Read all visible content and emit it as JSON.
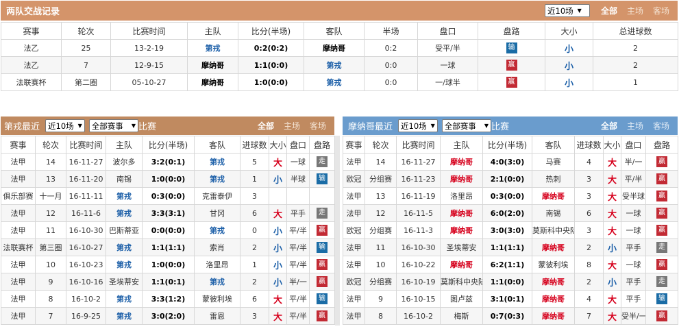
{
  "h2h": {
    "title": "两队交战记录",
    "select": "近10场",
    "filters": [
      "全部",
      "主场",
      "客场"
    ],
    "headers": [
      "赛事",
      "轮次",
      "比赛时间",
      "主队",
      "比分(半场)",
      "客队",
      "半场",
      "盘口",
      "盘路",
      "大小",
      "总进球数"
    ],
    "rows": [
      [
        "法乙",
        "25",
        "13-2-19",
        "第戎",
        "0:2(0:2)",
        "摩纳哥",
        "0:2",
        "受平/半",
        "输",
        "小",
        "2"
      ],
      [
        "法乙",
        "7",
        "12-9-15",
        "摩纳哥",
        "1:1(0:0)",
        "第戎",
        "0:0",
        "一球",
        "赢",
        "小",
        "2"
      ],
      [
        "法联赛杯",
        "第二圈",
        "05-10-27",
        "摩纳哥",
        "1:0(0:0)",
        "第戎",
        "0:0",
        "一/球半",
        "赢",
        "小",
        "1"
      ]
    ]
  },
  "left": {
    "title": "第戎最近",
    "select1": "近10场",
    "select2": "全部赛事",
    "suffix": "比赛",
    "filters": [
      "全部",
      "主场",
      "客场"
    ],
    "headers": [
      "赛事",
      "轮次",
      "比赛时间",
      "主队",
      "比分(半场)",
      "客队",
      "进球数",
      "大小",
      "盘口",
      "盘路"
    ],
    "rows": [
      [
        "法甲",
        "14",
        "16-11-27",
        "波尔多",
        "3:2(0:1)",
        "第戎",
        "5",
        "大",
        "一球",
        "走"
      ],
      [
        "法甲",
        "13",
        "16-11-20",
        "南锡",
        "1:0(0:0)",
        "第戎",
        "1",
        "小",
        "半球",
        "输"
      ],
      [
        "俱乐部赛",
        "十一月",
        "16-11-11",
        "第戎",
        "0:3(0:0)",
        "克雷泰伊",
        "3",
        "",
        "",
        ""
      ],
      [
        "法甲",
        "12",
        "16-11-6",
        "第戎",
        "3:3(3:1)",
        "甘冈",
        "6",
        "大",
        "平手",
        "走"
      ],
      [
        "法甲",
        "11",
        "16-10-30",
        "巴斯蒂亚",
        "0:0(0:0)",
        "第戎",
        "0",
        "小",
        "平/半",
        "赢"
      ],
      [
        "法联赛杯",
        "第三圈",
        "16-10-27",
        "第戎",
        "1:1(1:1)",
        "索肖",
        "2",
        "小",
        "平/半",
        "输"
      ],
      [
        "法甲",
        "10",
        "16-10-23",
        "第戎",
        "1:0(0:0)",
        "洛里昂",
        "1",
        "小",
        "平/半",
        "赢"
      ],
      [
        "法甲",
        "9",
        "16-10-16",
        "圣埃蒂安",
        "1:1(0:1)",
        "第戎",
        "2",
        "小",
        "半/一",
        "赢"
      ],
      [
        "法甲",
        "8",
        "16-10-2",
        "第戎",
        "3:3(1:2)",
        "蒙彼利埃",
        "6",
        "大",
        "平/半",
        "输"
      ],
      [
        "法甲",
        "7",
        "16-9-25",
        "第戎",
        "3:0(2:0)",
        "雷恩",
        "3",
        "大",
        "平/半",
        "赢"
      ]
    ]
  },
  "right": {
    "title": "摩纳哥最近",
    "select1": "近10场",
    "select2": "全部赛事",
    "suffix": "比赛",
    "filters": [
      "全部",
      "主场",
      "客场"
    ],
    "headers": [
      "赛事",
      "轮次",
      "比赛时间",
      "主队",
      "比分(半场)",
      "客队",
      "进球数",
      "大小",
      "盘口",
      "盘路"
    ],
    "rows": [
      [
        "法甲",
        "14",
        "16-11-27",
        "摩纳哥",
        "4:0(3:0)",
        "马赛",
        "4",
        "大",
        "半/一",
        "赢"
      ],
      [
        "欧冠",
        "分组赛",
        "16-11-23",
        "摩纳哥",
        "2:1(0:0)",
        "热刺",
        "3",
        "大",
        "平/半",
        "赢"
      ],
      [
        "法甲",
        "13",
        "16-11-19",
        "洛里昂",
        "0:3(0:0)",
        "摩纳哥",
        "3",
        "大",
        "受半球",
        "赢"
      ],
      [
        "法甲",
        "12",
        "16-11-5",
        "摩纳哥",
        "6:0(2:0)",
        "南锡",
        "6",
        "大",
        "一球",
        "赢"
      ],
      [
        "欧冠",
        "分组赛",
        "16-11-3",
        "摩纳哥",
        "3:0(3:0)",
        "莫斯科中央陆军",
        "3",
        "大",
        "一球",
        "赢"
      ],
      [
        "法甲",
        "11",
        "16-10-30",
        "圣埃蒂安",
        "1:1(1:1)",
        "摩纳哥",
        "2",
        "小",
        "平手",
        "走"
      ],
      [
        "法甲",
        "10",
        "16-10-22",
        "摩纳哥",
        "6:2(1:1)",
        "蒙彼利埃",
        "8",
        "大",
        "一球",
        "赢"
      ],
      [
        "欧冠",
        "分组赛",
        "16-10-19",
        "莫斯科中央陆军",
        "1:1(0:0)",
        "摩纳哥",
        "2",
        "小",
        "平手",
        "走"
      ],
      [
        "法甲",
        "9",
        "16-10-15",
        "图卢兹",
        "3:1(0:1)",
        "摩纳哥",
        "4",
        "大",
        "平手",
        "输"
      ],
      [
        "法甲",
        "8",
        "16-10-2",
        "梅斯",
        "0:7(0:3)",
        "摩纳哥",
        "7",
        "大",
        "受半/一",
        "赢"
      ]
    ]
  }
}
